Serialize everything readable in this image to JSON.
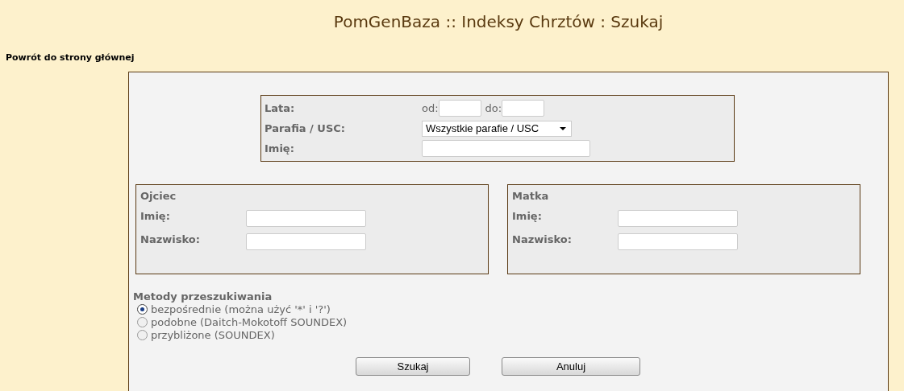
{
  "title": "PomGenBaza :: Indeksy Chrztów : Szukaj",
  "back_link": "Powrót do strony głównej",
  "filters": {
    "years_label": "Lata:",
    "from_label": "od:",
    "to_label": "do:",
    "parish_label": "Parafia / USC:",
    "parish_value": "Wszystkie parafie / USC",
    "name_label": "Imię:"
  },
  "parents": [
    {
      "title": "Ojciec",
      "name_label": "Imię:",
      "surname_label": "Nazwisko:"
    },
    {
      "title": "Matka",
      "name_label": "Imię:",
      "surname_label": "Nazwisko:"
    }
  ],
  "methods": {
    "title": "Metody przeszukiwania",
    "options": [
      {
        "label": "bezpośrednie (można użyć '*' i '?')",
        "selected": true
      },
      {
        "label": "podobne (Daitch-Mokotoff SOUNDEX)",
        "selected": false
      },
      {
        "label": "przybliżone (SOUNDEX)",
        "selected": false
      }
    ]
  },
  "buttons": [
    "Szukaj",
    "Anuluj"
  ]
}
